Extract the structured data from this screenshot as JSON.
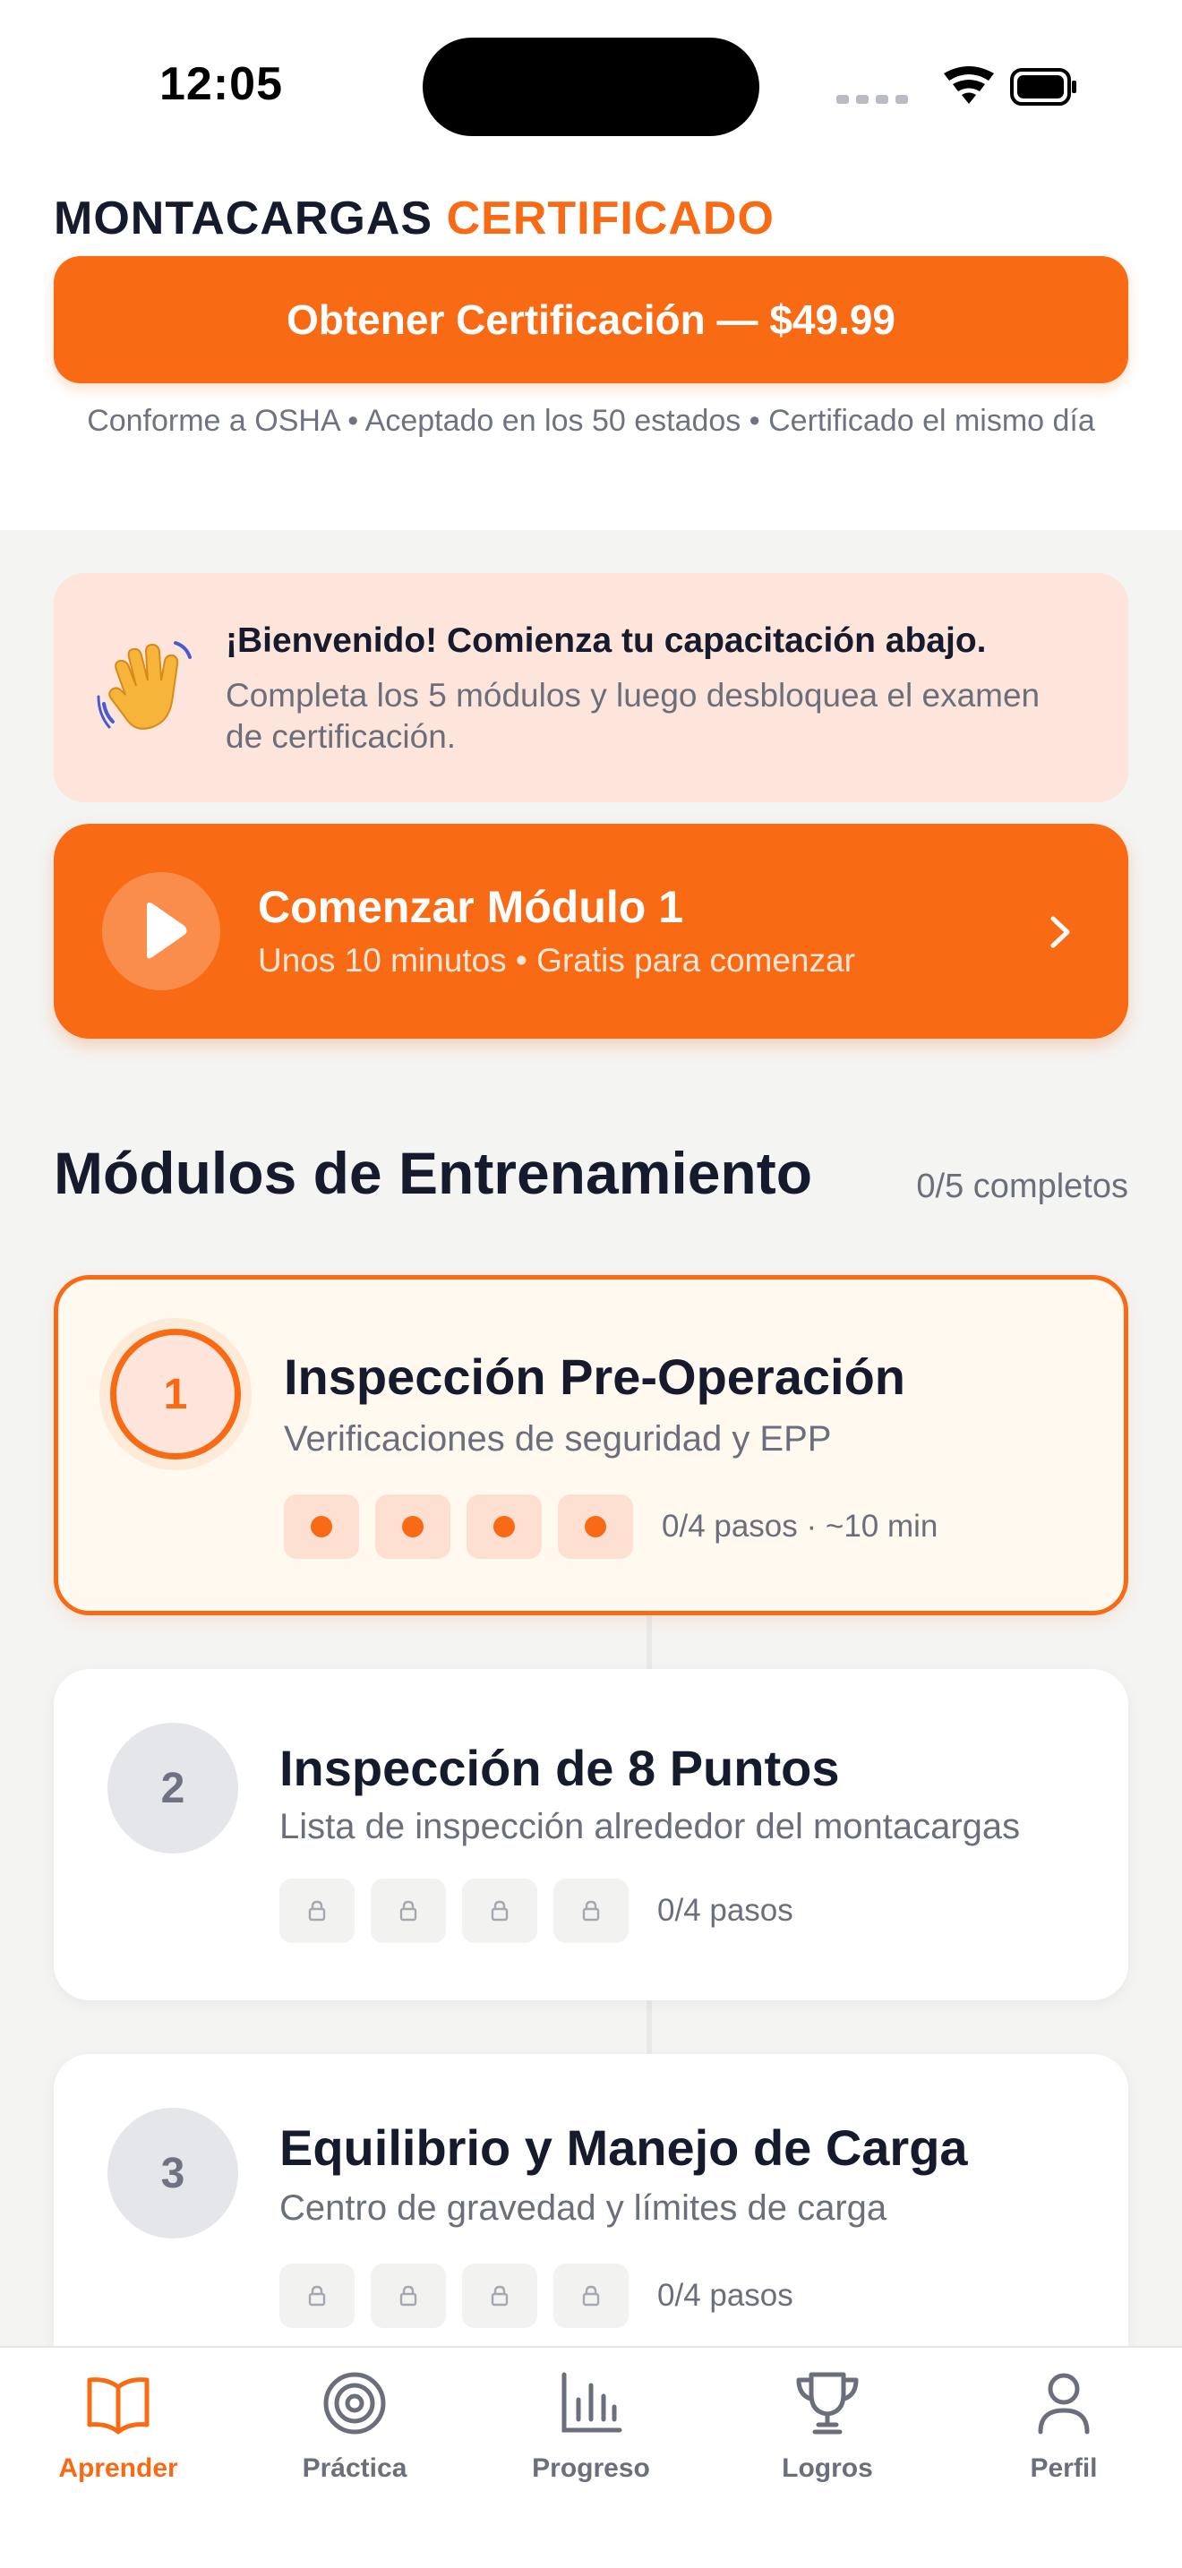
{
  "status_bar": {
    "time": "12:05"
  },
  "header": {
    "brand_primary": "MONTACARGAS",
    "brand_accent": "CERTIFICADO",
    "cta_label": "Obtener Certificación — $49.99",
    "compliance_text": "Conforme a OSHA • Aceptado en los 50 estados • Certificado el mismo día"
  },
  "welcome": {
    "icon": "waving-hand-icon",
    "title": "¡Bienvenido! Comienza tu capacitación abajo.",
    "body": "Completa los 5 módulos y luego desbloquea el examen de certificación."
  },
  "start_module": {
    "title": "Comenzar Módulo 1",
    "subtitle": "Unos 10 minutos • Gratis para comenzar"
  },
  "section": {
    "title": "Módulos de Entrenamiento",
    "count": "0/5 completos"
  },
  "modules": [
    {
      "number": "1",
      "title": "Inspección Pre-Operación",
      "subtitle": "Verificaciones de seguridad y EPP",
      "progress": "0/4 pasos · ~10 min",
      "state": "active"
    },
    {
      "number": "2",
      "title": "Inspección de 8 Puntos",
      "subtitle": "Lista de inspección alrededor del montacargas",
      "progress": "0/4 pasos",
      "state": "locked"
    },
    {
      "number": "3",
      "title": "Equilibrio y Manejo de Carga",
      "subtitle": "Centro de gravedad y límites de carga",
      "progress": "0/4 pasos",
      "state": "locked"
    }
  ],
  "tabs": [
    {
      "label": "Aprender",
      "icon": "book-icon",
      "active": true
    },
    {
      "label": "Práctica",
      "icon": "target-icon",
      "active": false
    },
    {
      "label": "Progreso",
      "icon": "bar-chart-icon",
      "active": false
    },
    {
      "label": "Logros",
      "icon": "trophy-icon",
      "active": false
    },
    {
      "label": "Perfil",
      "icon": "user-icon",
      "active": false
    }
  ],
  "colors": {
    "accent": "#f96a14",
    "accent_soft": "#fde5db",
    "text": "#151a2d",
    "muted": "#6b6f7c"
  }
}
